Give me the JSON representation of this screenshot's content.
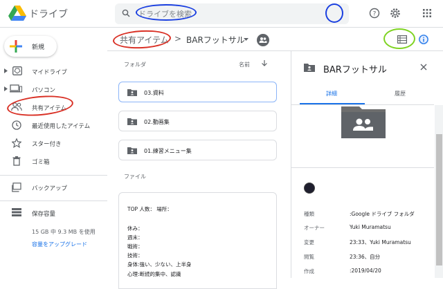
{
  "app": {
    "title": "ドライブ"
  },
  "search": {
    "placeholder": "ドライブを検索"
  },
  "sidebar": {
    "new_label": "新規",
    "items": [
      {
        "label": "マイドライブ"
      },
      {
        "label": "パソコン"
      },
      {
        "label": "共有アイテム"
      },
      {
        "label": "最近使用したアイテム"
      },
      {
        "label": "スター付き"
      },
      {
        "label": "ゴミ箱"
      },
      {
        "label": "バックアップ"
      },
      {
        "label": "保存容量"
      }
    ],
    "storage_usage": "15 GB 中 9.3 MB を使用",
    "upgrade_label": "容量をアップグレード"
  },
  "breadcrumb": {
    "root": "共有アイテム",
    "separator": ">",
    "current": "BARフットサル"
  },
  "main": {
    "folders_header": "フォルダ",
    "sort_label": "名前",
    "folders": [
      {
        "name": "03.資料"
      },
      {
        "name": "02.動画集"
      },
      {
        "name": "01.練習メニュー集"
      }
    ],
    "files_header": "ファイル",
    "doc_preview": [
      "TOP  人数：  場所：",
      "",
      "休み：",
      "週末：",
      "戦術：",
      "技術：",
      "身体:強い、少ない、上半身",
      "心理:断続的集中、認識"
    ]
  },
  "details": {
    "title": "BARフットサル",
    "tabs": [
      "詳細",
      "履歴"
    ],
    "properties": [
      {
        "key": "種類",
        "value": ":Google ドライブ フォルダ"
      },
      {
        "key": "オーナー",
        "value": "Yuki Muramatsu"
      },
      {
        "key": "変更",
        "value": "23:33、Yuki Muramatsu"
      },
      {
        "key": "閲覧",
        "value": "23:36、自分"
      },
      {
        "key": "作成",
        "value": ":2019/04/20"
      }
    ]
  },
  "colors": {
    "accent": "#1a73e8",
    "annotation_red": "#d93025",
    "annotation_blue": "#1a3fe0",
    "annotation_green": "#7ed321"
  },
  "icons": [
    "drive-logo-icon",
    "search-icon",
    "help-icon",
    "settings-icon",
    "apps-icon",
    "list-view-icon",
    "info-icon",
    "folder-shared-icon",
    "close-icon"
  ]
}
